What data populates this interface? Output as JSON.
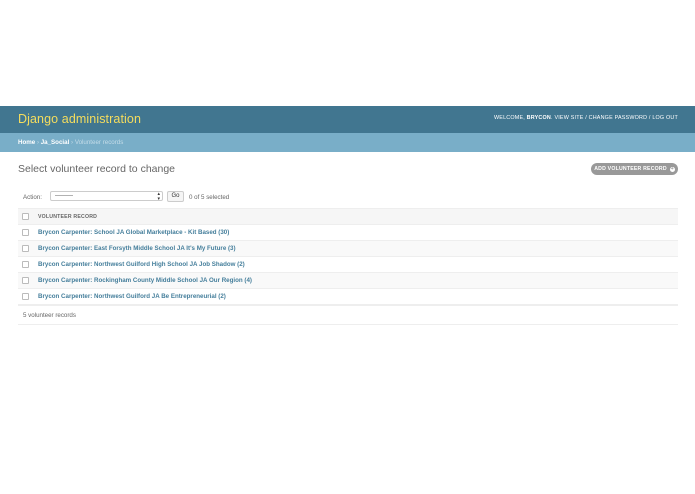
{
  "header": {
    "branding": "Django administration",
    "welcome": "WELCOME,",
    "user": "BRYCON",
    "view_site": "VIEW SITE",
    "change_password": "CHANGE PASSWORD",
    "log_out": "LOG OUT",
    "sep": "/"
  },
  "breadcrumbs": {
    "home": "Home",
    "app": "Ja_Social",
    "current": "Volunteer records",
    "sep": "›"
  },
  "content": {
    "title": "Select volunteer record to change",
    "add_button": "ADD VOLUNTEER RECORD",
    "add_icon": "+"
  },
  "actions": {
    "label": "Action:",
    "selected_value": "---------",
    "go_label": "Go",
    "selected_count": "0 of 5 selected"
  },
  "table": {
    "column_header": "VOLUNTEER RECORD",
    "rows": [
      "Brycon Carpenter: School JA Global Marketplace - Kit Based (30)",
      "Brycon Carpenter: East Forsyth Middle School JA It's My Future (3)",
      "Brycon Carpenter: Northwest Guilford High School JA Job Shadow (2)",
      "Brycon Carpenter: Rockingham County Middle School JA Our Region (4)",
      "Brycon Carpenter: Northwest Guilford JA Be Entrepreneurial (2)"
    ]
  },
  "paginator": {
    "text": "5 volunteer records"
  },
  "colors": {
    "header_bg": "#417690",
    "branding": "#f5dd5d",
    "breadcrumbs_bg": "#79aec8",
    "link": "#447e9b",
    "button_bg": "#999999"
  }
}
